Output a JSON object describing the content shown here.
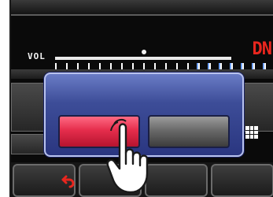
{
  "status": {
    "vol_label": "VOL",
    "mode_label": "DN",
    "mode_color": "#e8261e"
  },
  "dialog": {
    "confirm_button_color": "#e52d4c",
    "cancel_button_color": "#6a6a6a",
    "frame_color": "#3d4d98"
  },
  "softkeys": [
    {
      "icon": "back-arrow-icon"
    },
    {
      "icon": ""
    },
    {
      "icon": ""
    },
    {
      "icon": ""
    }
  ],
  "overlay": {
    "icon": "tapping-hand-icon"
  }
}
